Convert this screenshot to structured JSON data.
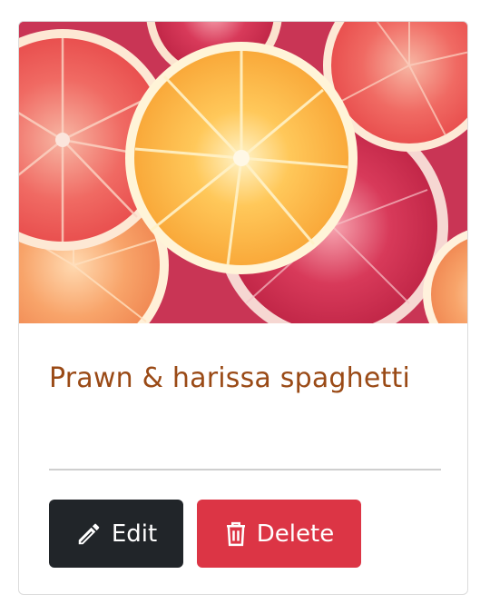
{
  "card": {
    "image": {
      "icon": "citrus-slices-photo"
    },
    "title": "Prawn & harissa spaghetti",
    "actions": {
      "edit_label": "Edit",
      "edit_icon": "pencil-icon",
      "delete_label": "Delete",
      "delete_icon": "trash-icon"
    }
  },
  "colors": {
    "title": "#9a4a16",
    "edit_button": "#212529",
    "delete_button": "#dc3545",
    "divider": "#cfcfcf"
  }
}
